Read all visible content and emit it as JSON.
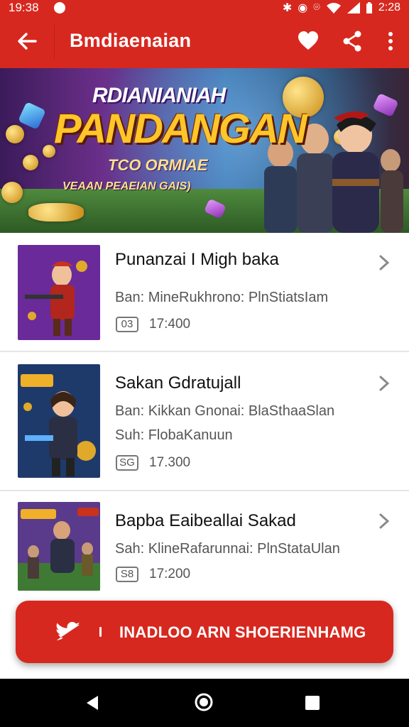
{
  "status_bar": {
    "time_left": "19:38",
    "time_right": "2:28"
  },
  "app_bar": {
    "title": "Bmdiaenaian"
  },
  "banner": {
    "line1": "RDIANIANIAH",
    "line2": "PANDANGAN",
    "line3": "TCO ORMIAE",
    "line4": "VEAAN PEAEIAN GAIS)"
  },
  "games": [
    {
      "title": "Punanzai I Migh baka",
      "subtitle": "Ban: MineRukhrono: PlnStiatsIam",
      "subtitle2": "",
      "badge": "03",
      "count": "17:400"
    },
    {
      "title": "Sakan Gdratujall",
      "subtitle": "Ban: Kikkan Gnonai: BlaSthaaSlan",
      "subtitle2": "Suh: FlobaKanuun",
      "badge": "SG",
      "count": "17.300"
    },
    {
      "title": "Bapba Eaibeallai Sakad",
      "subtitle": "Sah: KlineRafarunnai: PlnStataUlan",
      "subtitle2": "",
      "badge": "S8",
      "count": "17:200"
    }
  ],
  "cta": {
    "label": "INADLOO ARN SHOERIENHAMG"
  },
  "icons": {
    "back": "arrow-left-icon",
    "favorite": "heart-icon",
    "share": "share-icon",
    "more": "more-vertical-icon",
    "chevron": "chevron-right-icon",
    "twitter": "bird-icon",
    "nav_back": "triangle-back-icon",
    "nav_home": "home-circle-icon",
    "nav_recent": "square-recent-icon"
  },
  "colors": {
    "primary": "#d7281f",
    "text": "#111111",
    "muted": "#555555"
  }
}
